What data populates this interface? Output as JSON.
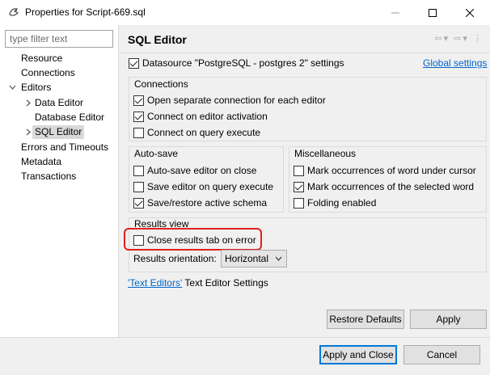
{
  "window": {
    "title": "Properties for Script-669.sql"
  },
  "sidebar": {
    "filter_placeholder": "type filter text",
    "items": [
      {
        "label": "Resource"
      },
      {
        "label": "Connections"
      },
      {
        "label": "Editors"
      },
      {
        "label": "Data Editor"
      },
      {
        "label": "Database Editor"
      },
      {
        "label": "SQL Editor"
      },
      {
        "label": "Errors and Timeouts"
      },
      {
        "label": "Metadata"
      },
      {
        "label": "Transactions"
      }
    ]
  },
  "page": {
    "title": "SQL Editor",
    "datasource_label": "Datasource \"PostgreSQL - postgres 2\" settings",
    "global_settings_link": "Global settings",
    "connections": {
      "label": "Connections",
      "open_separate": "Open separate connection for each editor",
      "connect_activation": "Connect on editor activation",
      "connect_query": "Connect on query execute"
    },
    "autosave": {
      "label": "Auto-save",
      "autosave_close": "Auto-save editor on close",
      "save_query": "Save editor on query execute",
      "save_restore_schema": "Save/restore active schema"
    },
    "misc": {
      "label": "Miscellaneous",
      "mark_cursor": "Mark occurrences of word under cursor",
      "mark_selected": "Mark occurrences of the selected word",
      "folding": "Folding enabled"
    },
    "results": {
      "label": "Results view",
      "close_on_error": "Close results tab on error",
      "orientation_label": "Results orientation:",
      "orientation_value": "Horizontal"
    },
    "text_editors_link": "'Text Editors'",
    "text_editors_suffix": " Text Editor Settings",
    "restore_defaults": "Restore Defaults",
    "apply": "Apply"
  },
  "footer": {
    "apply_close": "Apply and Close",
    "cancel": "Cancel"
  },
  "checks": {
    "datasource": true,
    "open_separate": true,
    "connect_activation": true,
    "connect_query": false,
    "autosave_close": false,
    "save_query": false,
    "save_restore_schema": true,
    "mark_cursor": false,
    "mark_selected": true,
    "folding": false,
    "close_on_error": false
  }
}
